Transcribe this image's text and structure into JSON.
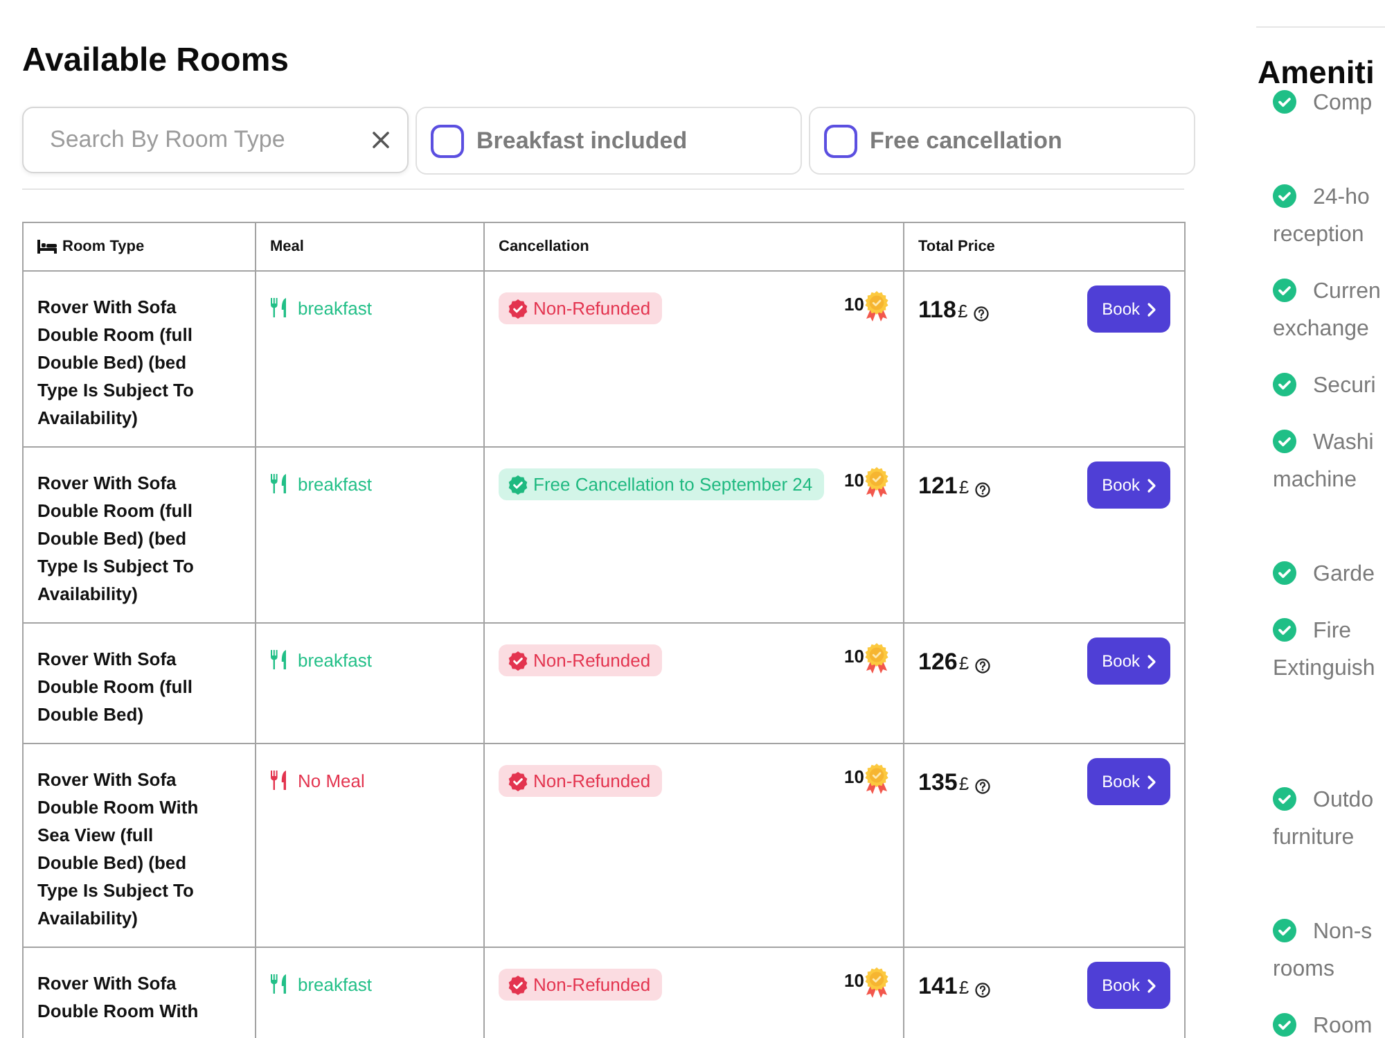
{
  "title": "Available Rooms",
  "filters": {
    "search": {
      "placeholder": "Search By Room Type"
    },
    "options": [
      {
        "label": "Breakfast included",
        "checked": false
      },
      {
        "label": "Free cancellation",
        "checked": false
      }
    ]
  },
  "table": {
    "columns": [
      "Room Type",
      "Meal",
      "Cancellation",
      "Total Price"
    ],
    "rows": [
      {
        "room_type": "Rover With Sofa Double Room (full Double Bed) (bed Type Is Subject To Availability)",
        "meal": {
          "label": "breakfast",
          "included": true
        },
        "cancellation": {
          "label": "Non-Refunded",
          "free": false
        },
        "points": "10",
        "price": "118",
        "currency": "£",
        "action": "Book"
      },
      {
        "room_type": "Rover With Sofa Double Room (full Double Bed) (bed Type Is Subject To Availability)",
        "meal": {
          "label": "breakfast",
          "included": true
        },
        "cancellation": {
          "label": "Free Cancellation to September 24",
          "free": true
        },
        "points": "10",
        "price": "121",
        "currency": "£",
        "action": "Book"
      },
      {
        "room_type": "Rover With Sofa Double Room (full Double Bed)",
        "meal": {
          "label": "breakfast",
          "included": true
        },
        "cancellation": {
          "label": "Non-Refunded",
          "free": false
        },
        "points": "10",
        "price": "126",
        "currency": "£",
        "action": "Book"
      },
      {
        "room_type": "Rover With Sofa Double Room With Sea View (full Double Bed) (bed Type Is Subject To Availability)",
        "meal": {
          "label": "No Meal",
          "included": false
        },
        "cancellation": {
          "label": "Non-Refunded",
          "free": false
        },
        "points": "10",
        "price": "135",
        "currency": "£",
        "action": "Book"
      },
      {
        "room_type": "Rover With Sofa Double Room With",
        "meal": {
          "label": "breakfast",
          "included": true
        },
        "cancellation": {
          "label": "Non-Refunded",
          "free": false
        },
        "points": "10",
        "price": "141",
        "currency": "£",
        "action": "Book"
      }
    ]
  },
  "amenities": {
    "title": "Ameniti",
    "items": [
      {
        "lines": [
          "Comp"
        ]
      },
      {
        "lines": [
          "24-ho",
          "reception"
        ]
      },
      {
        "lines": [
          "Curren",
          "exchange"
        ]
      },
      {
        "lines": [
          "Securi"
        ]
      },
      {
        "lines": [
          "Washi",
          "machine"
        ]
      },
      {
        "lines": [
          "Garde"
        ]
      },
      {
        "lines": [
          "Fire",
          "Extinguish"
        ]
      },
      {
        "lines": [
          "Outdo",
          "furniture"
        ]
      },
      {
        "lines": [
          "Non-s",
          "rooms"
        ]
      },
      {
        "lines": [
          "Room"
        ]
      }
    ]
  }
}
